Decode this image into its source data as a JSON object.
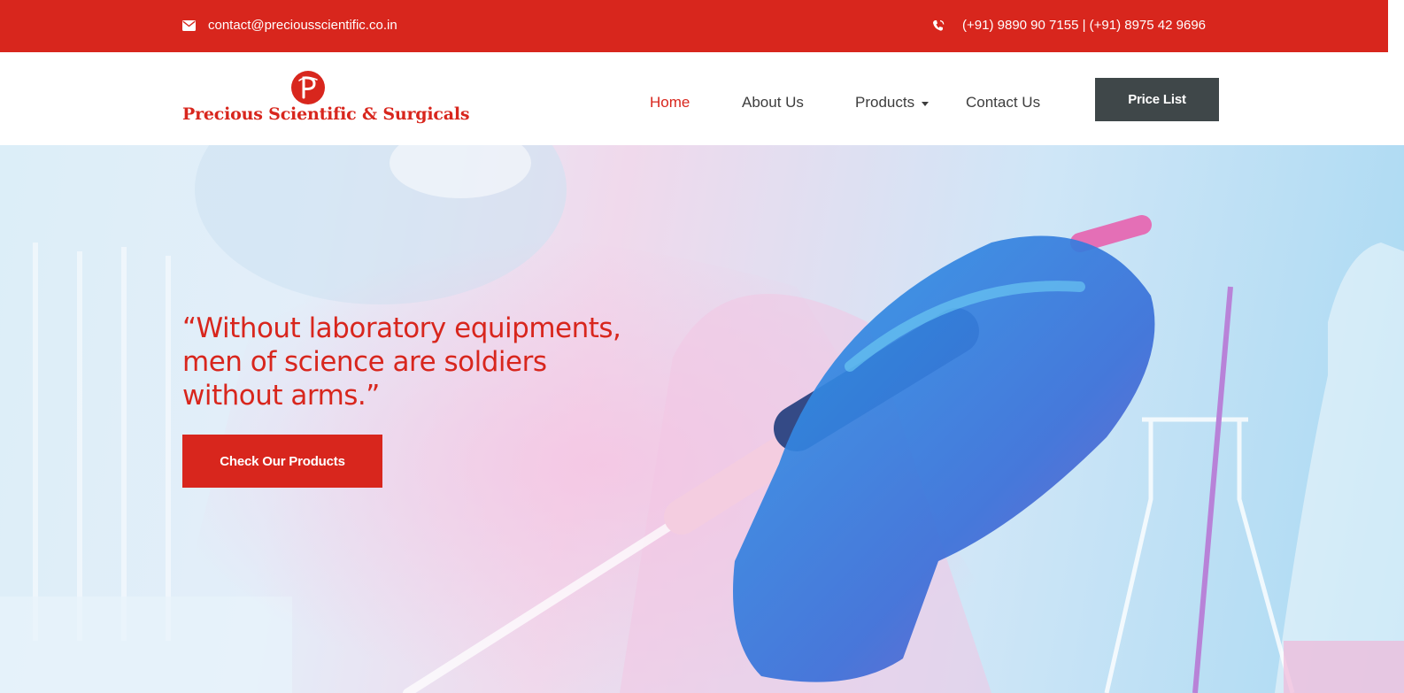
{
  "topbar": {
    "email": "contact@preciousscientific.co.in",
    "phones": "(+91) 9890 90 7155 | (+91) 8975 42 9696",
    "email_icon": "envelope-icon",
    "phone_icon": "phone-icon"
  },
  "header": {
    "logo_text": "Precious Scientific & Surgicals",
    "logo_mark": "P",
    "nav": {
      "home": "Home",
      "about": "About Us",
      "products": "Products",
      "contact": "Contact Us"
    },
    "price_list": "Price List"
  },
  "hero": {
    "quote": "“Without laboratory equipments, men of science are soldiers without arms.”",
    "cta": "Check Our Products"
  },
  "colors": {
    "brand_red": "#d8261d",
    "dark_button": "#3f4749",
    "nav_text": "#3d3d3d"
  }
}
